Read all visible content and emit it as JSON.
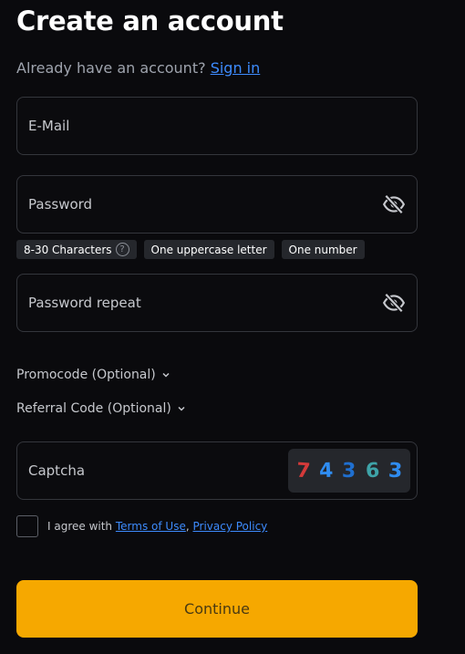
{
  "header": {
    "title": "Create an account"
  },
  "signin": {
    "prompt": "Already have an account?",
    "link": "Sign in"
  },
  "form": {
    "email": {
      "placeholder": "E-Mail",
      "value": ""
    },
    "password": {
      "placeholder": "Password",
      "value": ""
    },
    "password_rules": {
      "length": "8-30 Characters",
      "length_help": "?",
      "uppercase": "One uppercase letter",
      "number": "One number"
    },
    "password_repeat": {
      "placeholder": "Password repeat",
      "value": ""
    },
    "promocode_label": "Promocode (Optional)",
    "referral_label": "Referral Code (Optional)",
    "captcha": {
      "placeholder": "Captcha",
      "digits": [
        {
          "char": "7",
          "color": "#d43a3a"
        },
        {
          "char": "4",
          "color": "#2f8cf0"
        },
        {
          "char": "3",
          "color": "#1f6fd0"
        },
        {
          "char": "6",
          "color": "#3ea3a8"
        },
        {
          "char": "3",
          "color": "#2f8cf0"
        }
      ]
    },
    "agree": {
      "prefix": "I agree with",
      "terms": "Terms of Use",
      "separator": ",",
      "privacy": "Privacy Policy"
    },
    "submit_label": "Continue"
  },
  "colors": {
    "accent": "#f6a800",
    "link": "#3d8bfd",
    "background": "#0a0a0d"
  },
  "icons": {
    "eye": "eye-off-icon",
    "chevron": "chevron-down-icon",
    "help": "help-circle-icon"
  }
}
